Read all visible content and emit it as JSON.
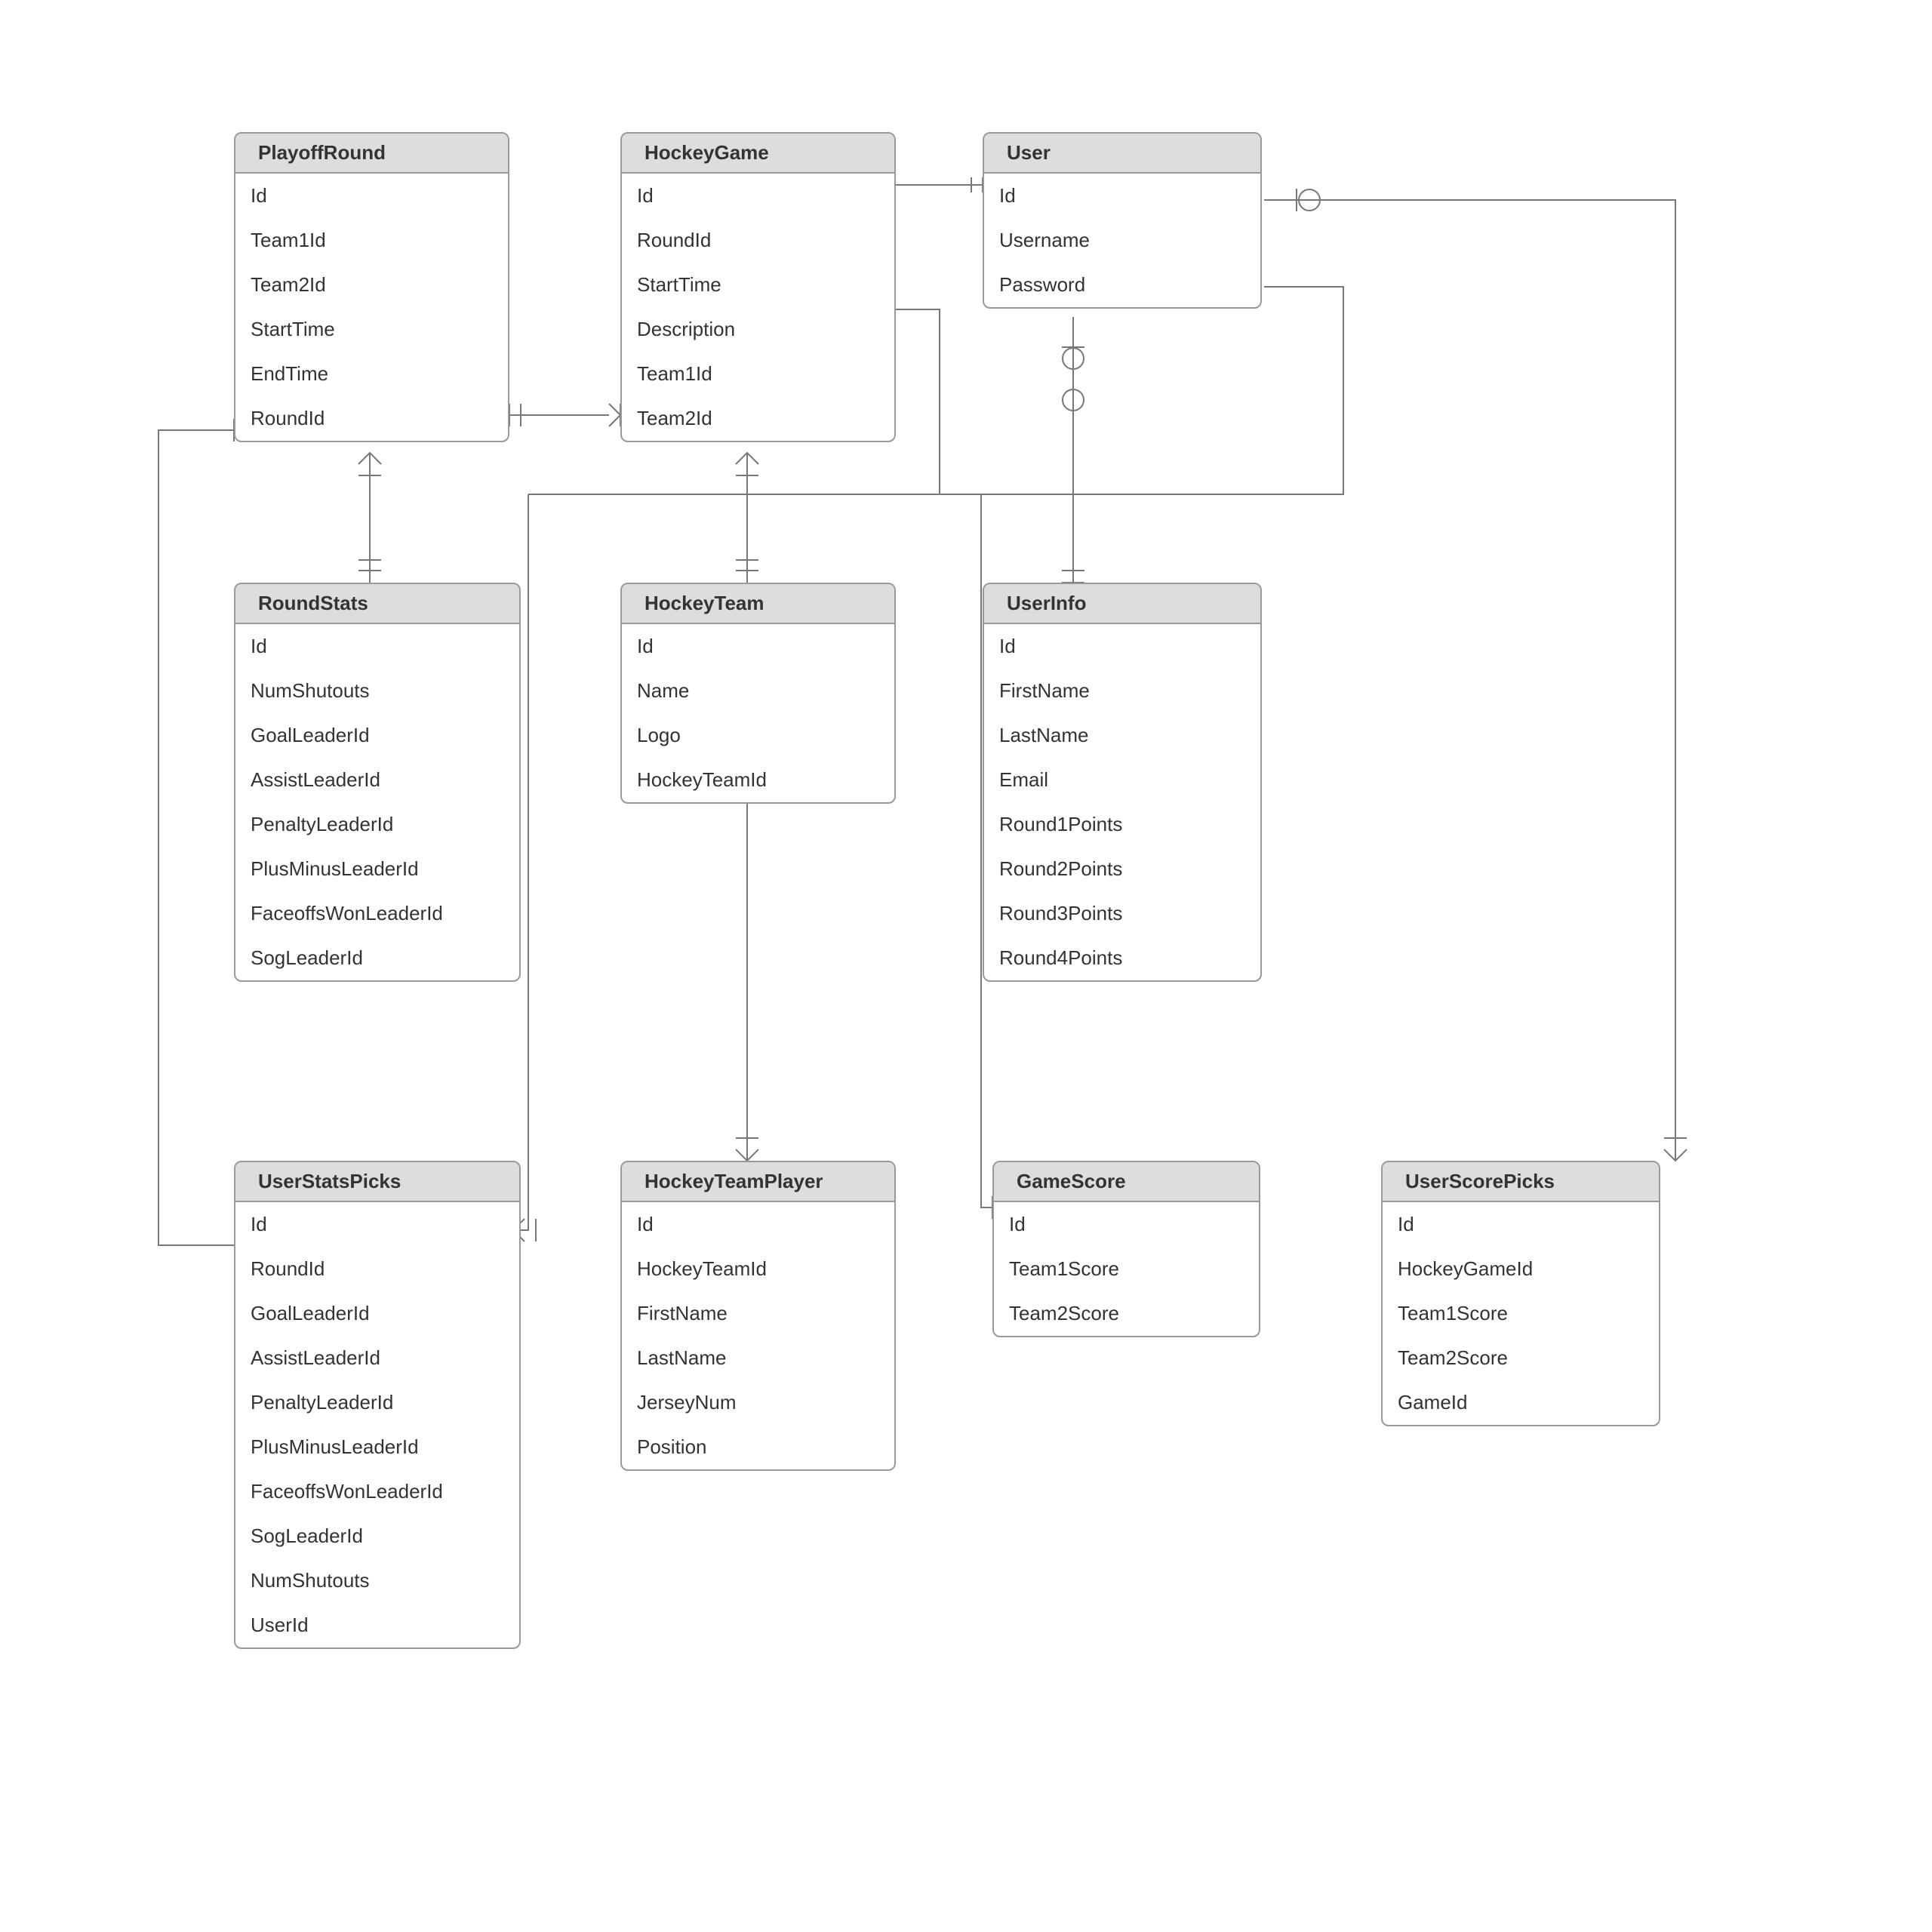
{
  "entities": [
    {
      "name": "PlayoffRound",
      "fields": [
        "Id",
        "Team1Id",
        "Team2Id",
        "StartTime",
        "EndTime",
        "RoundId"
      ]
    },
    {
      "name": "HockeyGame",
      "fields": [
        "Id",
        "RoundId",
        "StartTime",
        "Description",
        "Team1Id",
        "Team2Id"
      ]
    },
    {
      "name": "User",
      "fields": [
        "Id",
        "Username",
        "Password"
      ]
    },
    {
      "name": "RoundStats",
      "fields": [
        "Id",
        "NumShutouts",
        "GoalLeaderId",
        "AssistLeaderId",
        "PenaltyLeaderId",
        "PlusMinusLeaderId",
        "FaceoffsWonLeaderId",
        "SogLeaderId"
      ]
    },
    {
      "name": "HockeyTeam",
      "fields": [
        "Id",
        "Name",
        "Logo",
        "HockeyTeamId"
      ]
    },
    {
      "name": "UserInfo",
      "fields": [
        "Id",
        "FirstName",
        "LastName",
        "Email",
        "Round1Points",
        "Round2Points",
        "Round3Points",
        "Round4Points"
      ]
    },
    {
      "name": "UserStatsPicks",
      "fields": [
        "Id",
        "RoundId",
        "GoalLeaderId",
        "AssistLeaderId",
        "PenaltyLeaderId",
        "PlusMinusLeaderId",
        "FaceoffsWonLeaderId",
        "SogLeaderId",
        "NumShutouts",
        "UserId"
      ]
    },
    {
      "name": "HockeyTeamPlayer",
      "fields": [
        "Id",
        "HockeyTeamId",
        "FirstName",
        "LastName",
        "JerseyNum",
        "Position"
      ]
    },
    {
      "name": "GameScore",
      "fields": [
        "Id",
        "Team1Score",
        "Team2Score"
      ]
    },
    {
      "name": "UserScorePicks",
      "fields": [
        "Id",
        "HockeyGameId",
        "Team1Score",
        "Team2Score",
        "GameId"
      ]
    }
  ]
}
